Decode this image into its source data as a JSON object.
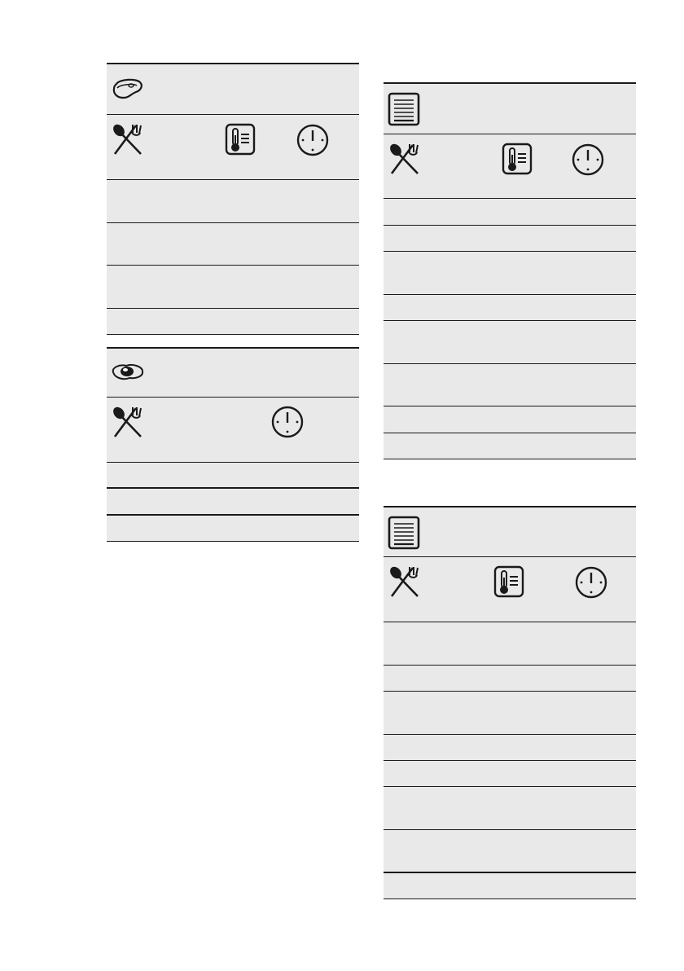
{
  "icons": {
    "steak": "steak-icon",
    "egg": "fried-egg-icon",
    "tray": "baking-tray-icon",
    "cutlery": "spoon-fork-icon",
    "thermometer": "temperature-icon",
    "clock": "clock-icon"
  },
  "tables": [
    {
      "id": "left-top",
      "category_icon": "steak-icon",
      "columns": [
        "spoon-fork-icon",
        "temperature-icon",
        "clock-icon"
      ],
      "row_count": 4
    },
    {
      "id": "left-bottom",
      "category_icon": "fried-egg-icon",
      "columns": [
        "spoon-fork-icon",
        "clock-icon"
      ],
      "row_count": 3
    },
    {
      "id": "right-top",
      "category_icon": "baking-tray-icon",
      "columns": [
        "spoon-fork-icon",
        "temperature-icon",
        "clock-icon"
      ],
      "row_count": 8
    },
    {
      "id": "right-bottom",
      "category_icon": "baking-tray-icon",
      "columns": [
        "spoon-fork-icon",
        "temperature-icon",
        "clock-icon"
      ],
      "row_count": 8
    }
  ],
  "colors": {
    "cell_fill": "#e9e9e9",
    "rule": "#1a1a1a"
  }
}
